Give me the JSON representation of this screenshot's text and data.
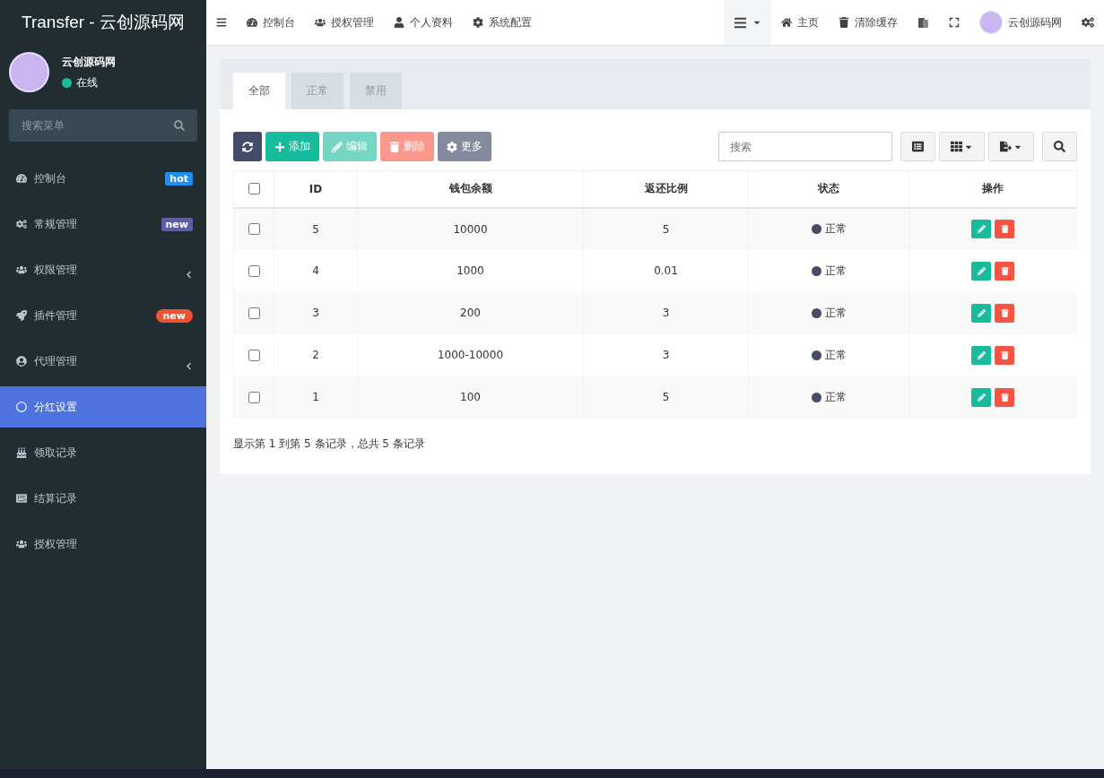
{
  "brand": {
    "title": "Transfer - 云创源码网"
  },
  "user": {
    "name": "云创源码网",
    "status": "在线"
  },
  "sidebar": {
    "search": {
      "placeholder": "搜索菜单"
    },
    "items": [
      {
        "label": "控制台",
        "badge": {
          "text": "hot",
          "color": "#1f8ff0",
          "kind": "label"
        },
        "has_children": false,
        "selected": false
      },
      {
        "label": "常规管理",
        "badge": {
          "text": "new",
          "color": "#605ca8",
          "kind": "label"
        },
        "has_children": false,
        "selected": false
      },
      {
        "label": "权限管理",
        "has_children": true,
        "selected": false
      },
      {
        "label": "插件管理",
        "badge": {
          "text": "new",
          "color": "#f05133",
          "kind": "pill"
        },
        "has_children": false,
        "selected": false
      },
      {
        "label": "代理管理",
        "has_children": true,
        "selected": false
      },
      {
        "label": "分红设置",
        "has_children": false,
        "selected": true
      },
      {
        "label": "领取记录",
        "has_children": false,
        "selected": false
      },
      {
        "label": "结算记录",
        "has_children": false,
        "selected": false
      },
      {
        "label": "授权管理",
        "has_children": false,
        "selected": false
      }
    ]
  },
  "topbar": {
    "nav": [
      "控制台",
      "授权管理",
      "个人资料",
      "系统配置"
    ],
    "links": [
      "主页",
      "清除缓存"
    ],
    "user": "云创源码网"
  },
  "tabs": [
    {
      "label": "全部",
      "selected": true
    },
    {
      "label": "正常",
      "selected": false
    },
    {
      "label": "禁用",
      "selected": false
    }
  ],
  "toolbar": {
    "buttons": [
      {
        "kind": "refresh",
        "disabled": false
      },
      {
        "kind": "add",
        "label": "添加",
        "disabled": false
      },
      {
        "kind": "edit",
        "label": "编辑",
        "disabled": true
      },
      {
        "kind": "delete",
        "label": "删除",
        "disabled": true
      },
      {
        "kind": "more",
        "label": "更多",
        "disabled": false
      }
    ],
    "search": {
      "placeholder": "搜索"
    }
  },
  "table": {
    "select_all_checked": false,
    "columns": [
      "ID",
      "钱包余额",
      "返还比例",
      "状态",
      "操作"
    ],
    "rows": [
      {
        "checked": false,
        "cells": [
          "5",
          "10000",
          "5"
        ],
        "status": "正常"
      },
      {
        "checked": false,
        "cells": [
          "4",
          "1000",
          "0.01"
        ],
        "status": "正常"
      },
      {
        "checked": false,
        "cells": [
          "3",
          "200",
          "3"
        ],
        "status": "正常"
      },
      {
        "checked": false,
        "cells": [
          "2",
          "1000-10000",
          "3"
        ],
        "status": "正常"
      },
      {
        "checked": false,
        "cells": [
          "1",
          "100",
          "5"
        ],
        "status": "正常"
      }
    ]
  },
  "pagination": {
    "summary": "显示第 1 到第 5 条记录，总共 5 条记录"
  }
}
